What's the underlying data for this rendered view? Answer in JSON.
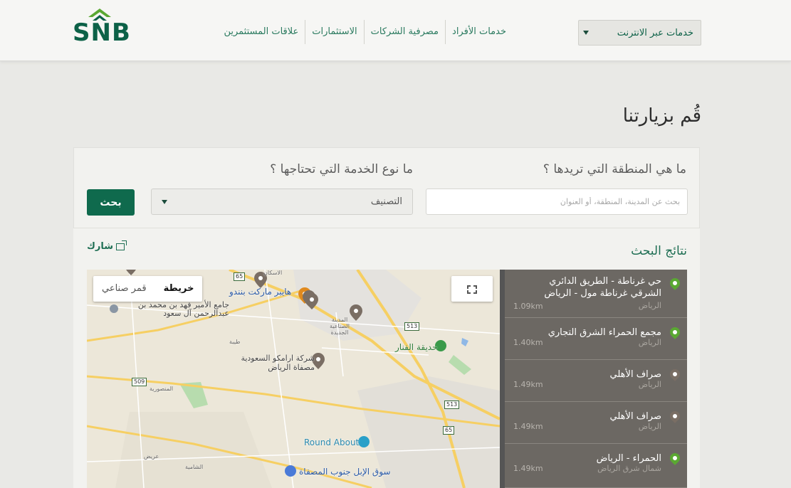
{
  "header": {
    "logo_text": "SNB",
    "nav": [
      {
        "label": "خدمات الأفراد"
      },
      {
        "label": "مصرفية الشركات"
      },
      {
        "label": "الاستثمارات"
      },
      {
        "label": "علاقات المستثمرين"
      }
    ],
    "online_services_label": "خدمات عبر الانترنت"
  },
  "page": {
    "title": "قُم بزيارتنا"
  },
  "search": {
    "area_question": "ما هي المنطقة التي تريدها ؟",
    "service_question": "ما نوع الخدمة التي تحتاجها ؟",
    "area_placeholder": "بحث عن المدينة، المنطقة، أو العنوان",
    "category_label": "التصنيف",
    "search_button": "بحث"
  },
  "results": {
    "title": "نتائج البحث",
    "share_label": "شارك",
    "items": [
      {
        "name": "حي غرناطة - الطريق الدائري الشرقي غرناطة مول - الرياض",
        "city": "الرياض",
        "distance": "1.09km",
        "pin_color": "#5aa832"
      },
      {
        "name": "مجمع الحمراء الشرق التجاري",
        "city": "الرياض",
        "distance": "1.40km",
        "pin_color": "#5aa832"
      },
      {
        "name": "صراف الأهلي",
        "city": "الرياض",
        "distance": "1.49km",
        "pin_color": "#7a6e64"
      },
      {
        "name": "صراف الأهلي",
        "city": "الرياض",
        "distance": "1.49km",
        "pin_color": "#7a6e64"
      },
      {
        "name": "الحمراء - الرياض",
        "city": "شمال شرق الرياض",
        "distance": "1.49km",
        "pin_color": "#5aa832"
      }
    ]
  },
  "map": {
    "type_map": "خريطة",
    "type_satellite": "قمر صناعي",
    "labels": {
      "hyper": "هايبر ماركت بنندو",
      "mosque": "جامع الأمير فهد بن محمد بن عبدالرحمن آل سعود",
      "aramco": "شركة ارامكو السعودية مصفاة الرياض",
      "park": "حديقة الفنار",
      "industrial": "المدينة الصناعية الجديدة",
      "roundabout": "Round About",
      "camel_market": "سوق الإبل جنوب المصفاة",
      "mansouria": "المنصورية",
      "tayba": "طيبة",
      "urayd": "عريض",
      "shamiya": "الشامية",
      "iskan": "الاسكان"
    },
    "roads": [
      "65",
      "513",
      "509",
      "513",
      "65"
    ]
  }
}
